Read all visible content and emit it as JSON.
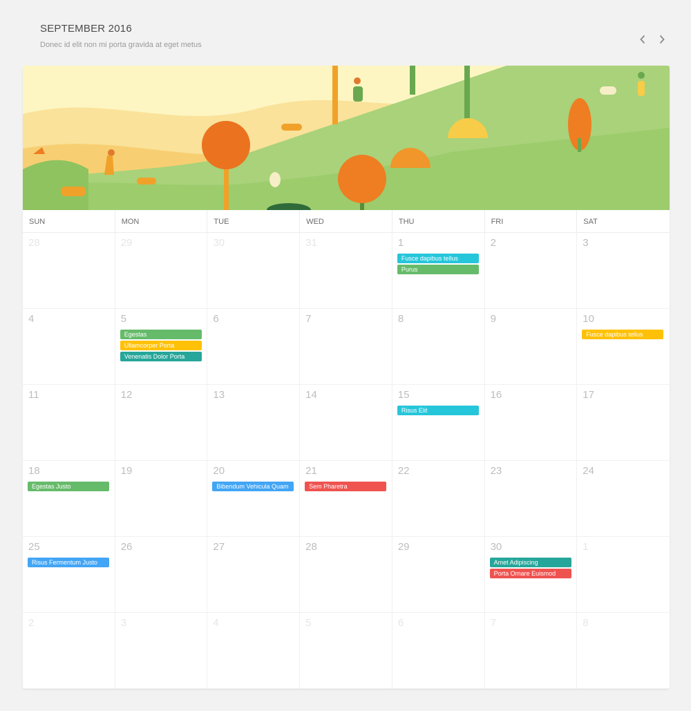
{
  "header": {
    "title": "SEPTEMBER 2016",
    "subtitle": "Donec id elit non mi porta gravida at eget metus"
  },
  "nav": {
    "prev_icon": "chevron-left-icon",
    "next_icon": "chevron-right-icon"
  },
  "colors": {
    "green": "#66bb6a",
    "cyan": "#26c6da",
    "amber": "#ffc107",
    "teal": "#26a69a",
    "blue": "#42a5f5",
    "red": "#ef5350"
  },
  "weekdays": [
    "SUN",
    "MON",
    "TUE",
    "WED",
    "THU",
    "FRI",
    "SAT"
  ],
  "days": [
    {
      "num": "28",
      "muted": true,
      "events": []
    },
    {
      "num": "29",
      "muted": true,
      "events": []
    },
    {
      "num": "30",
      "muted": true,
      "events": []
    },
    {
      "num": "31",
      "muted": true,
      "events": []
    },
    {
      "num": "1",
      "muted": false,
      "events": [
        {
          "label": "Fusce dapibus tellus",
          "color": "cyan"
        },
        {
          "label": "Purus",
          "color": "green"
        }
      ]
    },
    {
      "num": "2",
      "muted": false,
      "events": []
    },
    {
      "num": "3",
      "muted": false,
      "events": []
    },
    {
      "num": "4",
      "muted": false,
      "events": []
    },
    {
      "num": "5",
      "muted": false,
      "events": [
        {
          "label": "Egestas",
          "color": "green"
        },
        {
          "label": "Ullamcorper Porta",
          "color": "amber"
        },
        {
          "label": "Venenatis Dolor Porta",
          "color": "teal"
        }
      ]
    },
    {
      "num": "6",
      "muted": false,
      "events": []
    },
    {
      "num": "7",
      "muted": false,
      "events": []
    },
    {
      "num": "8",
      "muted": false,
      "events": []
    },
    {
      "num": "9",
      "muted": false,
      "events": []
    },
    {
      "num": "10",
      "muted": false,
      "events": [
        {
          "label": "Fusce dapibus tellus",
          "color": "amber"
        }
      ]
    },
    {
      "num": "11",
      "muted": false,
      "events": []
    },
    {
      "num": "12",
      "muted": false,
      "events": []
    },
    {
      "num": "13",
      "muted": false,
      "events": []
    },
    {
      "num": "14",
      "muted": false,
      "events": []
    },
    {
      "num": "15",
      "muted": false,
      "events": [
        {
          "label": "Risus Elit",
          "color": "cyan"
        }
      ]
    },
    {
      "num": "16",
      "muted": false,
      "events": []
    },
    {
      "num": "17",
      "muted": false,
      "events": []
    },
    {
      "num": "18",
      "muted": false,
      "events": [
        {
          "label": "Egestas Justo",
          "color": "green"
        }
      ]
    },
    {
      "num": "19",
      "muted": false,
      "events": []
    },
    {
      "num": "20",
      "muted": false,
      "events": [
        {
          "label": "Bibendum Vehicula Quam",
          "color": "blue"
        }
      ]
    },
    {
      "num": "21",
      "muted": false,
      "events": [
        {
          "label": "Sem Pharetra",
          "color": "red"
        }
      ]
    },
    {
      "num": "22",
      "muted": false,
      "events": []
    },
    {
      "num": "23",
      "muted": false,
      "events": []
    },
    {
      "num": "24",
      "muted": false,
      "events": []
    },
    {
      "num": "25",
      "muted": false,
      "events": [
        {
          "label": "Risus Fermentum Justo",
          "color": "blue"
        }
      ]
    },
    {
      "num": "26",
      "muted": false,
      "events": []
    },
    {
      "num": "27",
      "muted": false,
      "events": []
    },
    {
      "num": "28",
      "muted": false,
      "events": []
    },
    {
      "num": "29",
      "muted": false,
      "events": []
    },
    {
      "num": "30",
      "muted": false,
      "events": [
        {
          "label": "Amet Adipiscing",
          "color": "teal"
        },
        {
          "label": "Porta Ornare Euismod",
          "color": "red"
        }
      ]
    },
    {
      "num": "1",
      "muted": true,
      "events": []
    },
    {
      "num": "2",
      "muted": true,
      "events": []
    },
    {
      "num": "3",
      "muted": true,
      "events": []
    },
    {
      "num": "4",
      "muted": true,
      "events": []
    },
    {
      "num": "5",
      "muted": true,
      "events": []
    },
    {
      "num": "6",
      "muted": true,
      "events": []
    },
    {
      "num": "7",
      "muted": true,
      "events": []
    },
    {
      "num": "8",
      "muted": true,
      "events": []
    }
  ]
}
